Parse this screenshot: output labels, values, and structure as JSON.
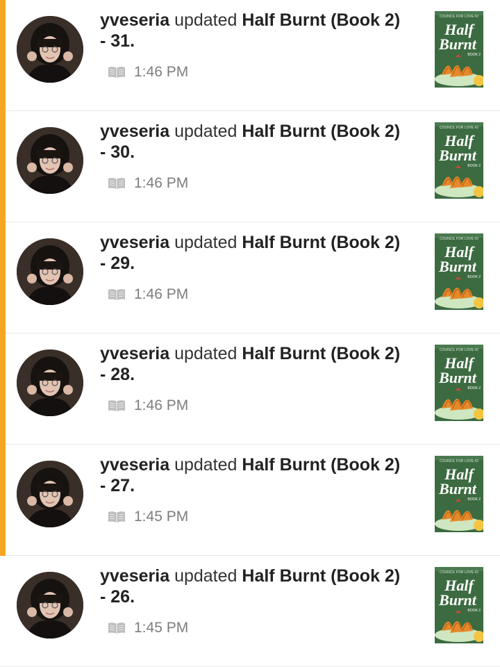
{
  "feed": {
    "items": [
      {
        "user": "yveseria",
        "verb": "updated",
        "story": "Half Burnt (Book 2) - 31.",
        "time": "1:46 PM",
        "unread": true
      },
      {
        "user": "yveseria",
        "verb": "updated",
        "story": "Half Burnt (Book 2) - 30.",
        "time": "1:46 PM",
        "unread": true
      },
      {
        "user": "yveseria",
        "verb": "updated",
        "story": "Half Burnt (Book 2) - 29.",
        "time": "1:46 PM",
        "unread": true
      },
      {
        "user": "yveseria",
        "verb": "updated",
        "story": "Half Burnt (Book 2) - 28.",
        "time": "1:46 PM",
        "unread": true
      },
      {
        "user": "yveseria",
        "verb": "updated",
        "story": "Half Burnt (Book 2) - 27.",
        "time": "1:45 PM",
        "unread": true
      },
      {
        "user": "yveseria",
        "verb": "updated",
        "story": "Half Burnt (Book 2) - 26.",
        "time": "1:45 PM",
        "unread": false
      }
    ],
    "cover": {
      "series": "COUNCIL FOR LOVE #2",
      "title_line1": "Half",
      "title_line2": "Burnt",
      "book": "BOOK 2"
    },
    "icons": {
      "time_type": "book-icon"
    },
    "colors": {
      "unread_bar": "#f5a623",
      "cover_green": "#3c6b41",
      "text": "#222222",
      "meta": "#7d7d7d"
    }
  }
}
